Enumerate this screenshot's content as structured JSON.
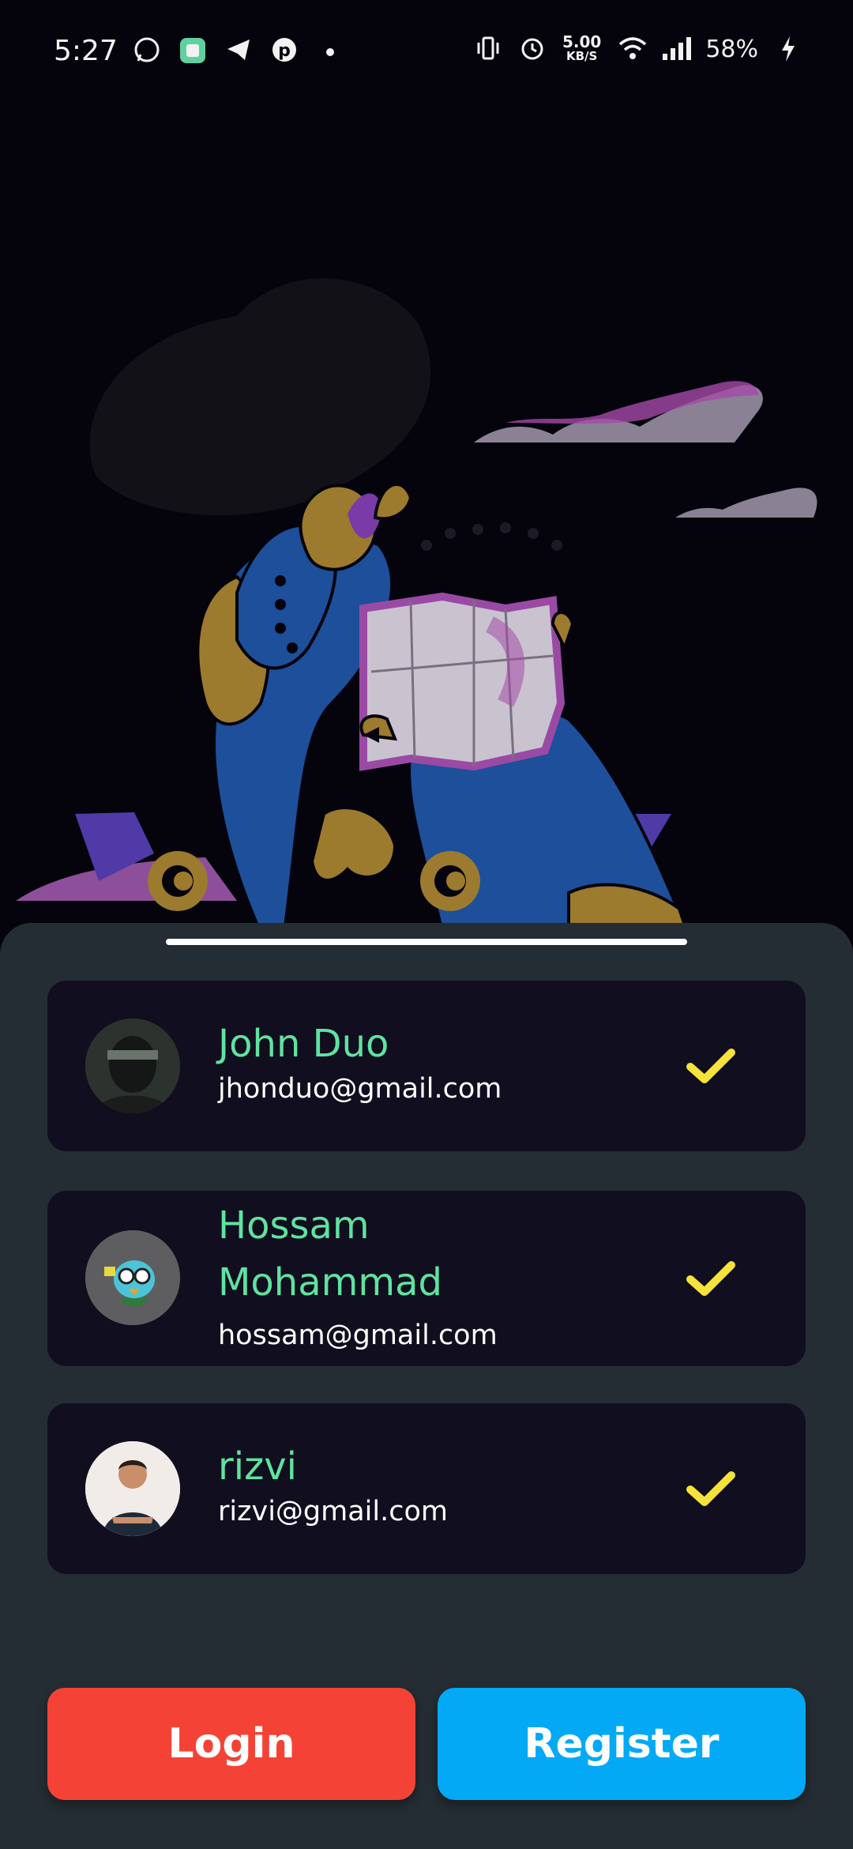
{
  "status_bar": {
    "time": "5:27",
    "left_icons": [
      "whatsapp-icon",
      "app-icon",
      "telegram-icon",
      "pinterest-icon",
      "dot-icon"
    ],
    "speed_value": "5.00",
    "speed_unit": "KB/S",
    "battery": "58%"
  },
  "accounts": [
    {
      "name": "John Duo",
      "email": "jhonduo@gmail.com",
      "selected": true
    },
    {
      "name": "Hossam Mohammad",
      "email": "hossam@gmail.com",
      "selected": true
    },
    {
      "name": "rizvi",
      "email": "rizvi@gmail.com",
      "selected": true
    }
  ],
  "buttons": {
    "login": "Login",
    "register": "Register"
  },
  "colors": {
    "name": "#5fe3a0",
    "check": "#f5e23a",
    "login": "#f44336",
    "register": "#03a9f4",
    "sheet": "#242d33",
    "card": "#110e1f"
  }
}
